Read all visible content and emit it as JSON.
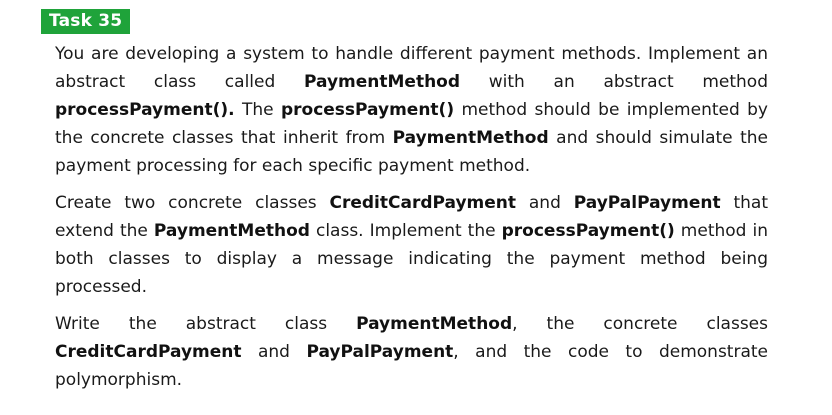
{
  "task": {
    "label": "Task 35"
  },
  "paragraphs": [
    [
      {
        "t": "You are developing a system to handle different payment methods. Implement an abstract class called ",
        "b": false
      },
      {
        "t": "PaymentMethod",
        "b": true
      },
      {
        "t": " with an abstract method ",
        "b": false
      },
      {
        "t": "processPayment().",
        "b": true
      },
      {
        "t": " The ",
        "b": false
      },
      {
        "t": "processPayment()",
        "b": true
      },
      {
        "t": " method should be implemented by the concrete classes that inherit from ",
        "b": false
      },
      {
        "t": "PaymentMethod",
        "b": true
      },
      {
        "t": " and should simulate the payment processing for each specific payment method.",
        "b": false
      }
    ],
    [
      {
        "t": "Create two concrete classes ",
        "b": false
      },
      {
        "t": "CreditCardPayment",
        "b": true
      },
      {
        "t": " and ",
        "b": false
      },
      {
        "t": "PayPalPayment",
        "b": true
      },
      {
        "t": " that extend the ",
        "b": false
      },
      {
        "t": "PaymentMethod",
        "b": true
      },
      {
        "t": " class. Implement the ",
        "b": false
      },
      {
        "t": "processPayment()",
        "b": true
      },
      {
        "t": " method in both classes to display a message indicating the payment method being processed.",
        "b": false
      }
    ],
    [
      {
        "t": "Write the abstract class ",
        "b": false
      },
      {
        "t": "PaymentMethod",
        "b": true
      },
      {
        "t": ", the concrete classes ",
        "b": false
      },
      {
        "t": "CreditCardPayment",
        "b": true
      },
      {
        "t": " and ",
        "b": false
      },
      {
        "t": "PayPalPayment",
        "b": true
      },
      {
        "t": ", and the code to demonstrate polymorphism.",
        "b": false
      }
    ]
  ]
}
